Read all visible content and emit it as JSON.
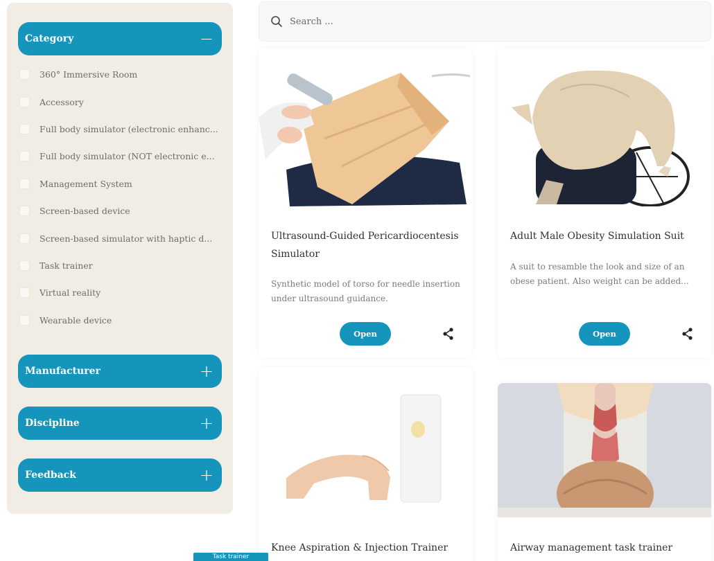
{
  "search": {
    "placeholder": "Search ..."
  },
  "filters": {
    "category": {
      "label": "Category",
      "toggle": "−",
      "items": [
        "360° Immersive Room",
        "Accessory",
        "Full body simulator (electronic enhanc...",
        "Full body simulator (NOT electronic e...",
        "Management System",
        "Screen-based device",
        "Screen-based simulator with haptic d...",
        "Task trainer",
        "Virtual reality",
        "Wearable device"
      ]
    },
    "manufacturer": {
      "label": "Manufacturer",
      "toggle": "+"
    },
    "discipline": {
      "label": "Discipline",
      "toggle": "+"
    },
    "feedback": {
      "label": "Feedback",
      "toggle": "+"
    }
  },
  "cards": [
    {
      "title": "Ultrasound-Guided Pericardiocentesis Simulator",
      "description": "Synthetic model of torso for needle insertion under ultrasound guidance.",
      "button": "Open"
    },
    {
      "title": "Adult Male Obesity Simulation Suit",
      "description": "A suit to resamble the look and size of an obese patient. Also weight can be added...",
      "button": "Open"
    },
    {
      "title": "Knee Aspiration & Injection Trainer",
      "description": "",
      "button": ""
    },
    {
      "title": "Airway management task trainer",
      "description": "",
      "button": ""
    }
  ],
  "tooltip": "Task trainer",
  "colors": {
    "accent": "#1595bb",
    "sidebar_bg": "#f2ede4"
  }
}
